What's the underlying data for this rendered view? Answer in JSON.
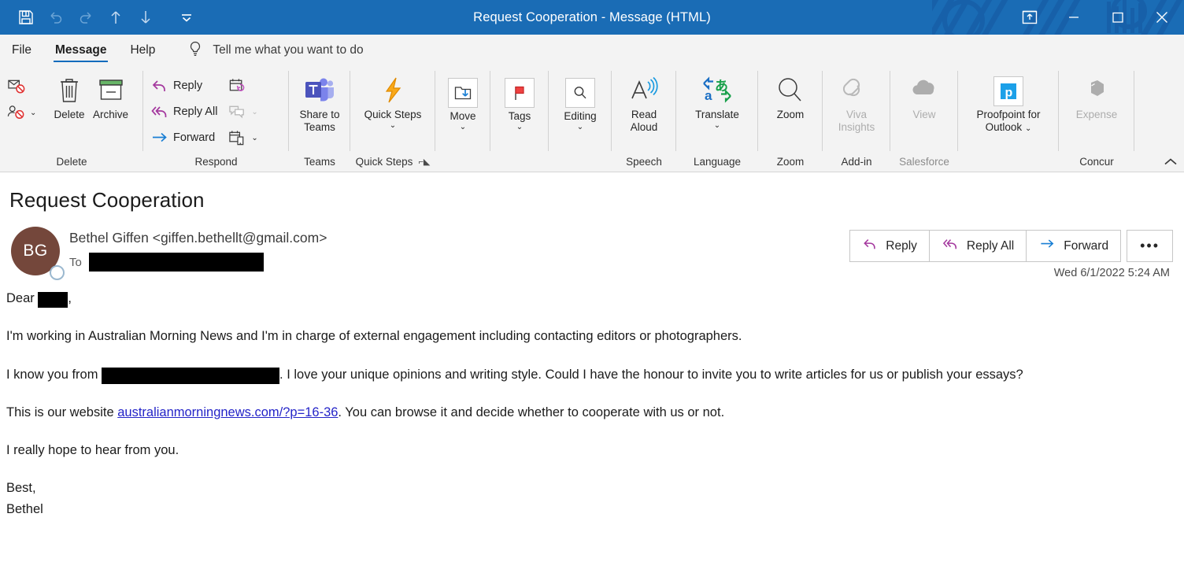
{
  "window": {
    "title": "Request Cooperation  -  Message (HTML)",
    "quick_access": [
      {
        "name": "save-icon",
        "label": "Save",
        "enabled": true
      },
      {
        "name": "undo-icon",
        "label": "Undo",
        "enabled": false
      },
      {
        "name": "redo-icon",
        "label": "Redo",
        "enabled": false
      },
      {
        "name": "previous-item-icon",
        "label": "Previous Item",
        "enabled": true
      },
      {
        "name": "next-item-icon",
        "label": "Next Item",
        "enabled": true
      },
      {
        "name": "customize-quick-access-toolbar-icon",
        "label": "Customize Quick Access Toolbar",
        "enabled": true
      }
    ],
    "controls": [
      {
        "name": "restore-down-ribbon-icon",
        "label": "Ribbon Display Options"
      },
      {
        "name": "minimize-icon",
        "label": "Minimize"
      },
      {
        "name": "maximize-icon",
        "label": "Maximize"
      },
      {
        "name": "close-icon",
        "label": "Close"
      }
    ],
    "titlebar_color": "#1a6cb5"
  },
  "tabs": [
    {
      "label": "File",
      "active": false
    },
    {
      "label": "Message",
      "active": true
    },
    {
      "label": "Help",
      "active": false
    }
  ],
  "tellme": {
    "icon": "lightbulb-icon",
    "placeholder": "Tell me what you want to do"
  },
  "ribbon": {
    "collapse_label": "Collapse the Ribbon",
    "groups": [
      {
        "name": "delete",
        "label": "Delete",
        "dim": false,
        "small_buttons": [
          {
            "label": "Ignore",
            "icon": "ignore-icon",
            "has_chevron": false
          },
          {
            "label": "Block Sender",
            "icon": "block-sender-icon",
            "has_chevron": true
          }
        ],
        "buttons": [
          {
            "label": "Delete",
            "icon": "trash-icon",
            "dim": false,
            "chevron": false
          },
          {
            "label": "Archive",
            "icon": "archive-icon",
            "dim": false,
            "chevron": false
          }
        ]
      },
      {
        "name": "respond",
        "label": "Respond",
        "dim": false,
        "respond_items": [
          {
            "label": "Reply",
            "icon": "reply-arrow-icon"
          },
          {
            "label": "Reply All",
            "icon": "reply-all-arrow-icon"
          },
          {
            "label": "Forward",
            "icon": "forward-arrow-icon"
          }
        ],
        "respond_extra": [
          {
            "label": "Meeting",
            "icon": "calendar-reply-icon",
            "has_chevron": false
          },
          {
            "label": "More Respond Options",
            "icon": "chat-bubbles-icon",
            "has_chevron": true
          },
          {
            "label": "Reply with Meeting",
            "icon": "calendar-mobile-icon",
            "has_chevron": true
          }
        ]
      },
      {
        "name": "teams",
        "label": "Teams",
        "dim": false,
        "buttons": [
          {
            "label": "Share to Teams",
            "icon": "microsoft-teams-icon",
            "dim": false,
            "chevron": false
          }
        ]
      },
      {
        "name": "quick-steps",
        "label": "Quick Steps",
        "dim": false,
        "has_dialog_launcher": true,
        "buttons": [
          {
            "label": "Quick Steps",
            "icon": "lightning-bolt-icon",
            "dim": false,
            "chevron": true
          }
        ]
      },
      {
        "name": "move",
        "label": "",
        "dim": false,
        "buttons": [
          {
            "label": "Move",
            "icon": "move-folder-icon",
            "dim": false,
            "chevron": true
          }
        ]
      },
      {
        "name": "tags",
        "label": "",
        "dim": false,
        "buttons": [
          {
            "label": "Tags",
            "icon": "red-flag-icon",
            "dim": false,
            "chevron": true
          }
        ]
      },
      {
        "name": "editing",
        "label": "",
        "dim": false,
        "buttons": [
          {
            "label": "Editing",
            "icon": "magnifier-icon",
            "dim": false,
            "chevron": true
          }
        ]
      },
      {
        "name": "speech",
        "label": "Speech",
        "dim": false,
        "buttons": [
          {
            "label": "Read Aloud",
            "icon": "read-aloud-icon",
            "dim": false,
            "chevron": false
          }
        ]
      },
      {
        "name": "language",
        "label": "Language",
        "dim": false,
        "buttons": [
          {
            "label": "Translate",
            "icon": "translate-icon",
            "dim": false,
            "chevron": true
          }
        ]
      },
      {
        "name": "zoom",
        "label": "Zoom",
        "dim": false,
        "buttons": [
          {
            "label": "Zoom",
            "icon": "zoom-magnifier-icon",
            "dim": false,
            "chevron": false
          }
        ]
      },
      {
        "name": "add-in",
        "label": "Add-in",
        "dim": false,
        "buttons": [
          {
            "label": "Viva Insights",
            "icon": "viva-insights-icon",
            "dim": true,
            "chevron": false
          }
        ]
      },
      {
        "name": "salesforce",
        "label": "Salesforce",
        "dim": false,
        "buttons": [
          {
            "label": "View",
            "icon": "salesforce-cloud-icon",
            "dim": true,
            "chevron": false
          }
        ]
      },
      {
        "name": "proofpoint",
        "label": "",
        "dim": false,
        "buttons": [
          {
            "label": "Proofpoint for Outlook",
            "icon": "proofpoint-icon",
            "dim": false,
            "chevron": true
          }
        ]
      },
      {
        "name": "concur",
        "label": "Concur",
        "dim": false,
        "buttons": [
          {
            "label": "Expense",
            "icon": "concur-expense-icon",
            "dim": true,
            "chevron": false
          }
        ]
      }
    ]
  },
  "message": {
    "subject": "Request Cooperation",
    "avatar_initials": "BG",
    "avatar_color": "#74473b",
    "sender": "Bethel Giffen <giffen.bethellt@gmail.com>",
    "to_label": "To",
    "to_value_redacted": true,
    "timestamp": "Wed 6/1/2022 5:24 AM",
    "actions": [
      {
        "label": "Reply",
        "icon": "reply-arrow-icon"
      },
      {
        "label": "Reply All",
        "icon": "reply-all-arrow-icon"
      },
      {
        "label": "Forward",
        "icon": "forward-arrow-icon"
      },
      {
        "label": "More actions",
        "icon": "ellipsis-icon"
      }
    ],
    "body": {
      "greeting_prefix": "Dear ",
      "greeting_suffix": ",",
      "para1": "I'm working in Australian Morning News and I'm in charge of external engagement including contacting editors or photographers.",
      "para2_prefix": "I know you from ",
      "para2_suffix": ". I love your unique opinions and writing style. Could I have the honour to invite you to write articles for us or publish your essays?",
      "para3_prefix": "This is our website ",
      "para3_link": "australianmorningnews.com/?p=16-36",
      "para3_suffix": ". You can browse it and decide whether to cooperate with us or not.",
      "para4": "I really hope to hear from you.",
      "signoff": "Best,",
      "signature": "Bethel"
    }
  }
}
